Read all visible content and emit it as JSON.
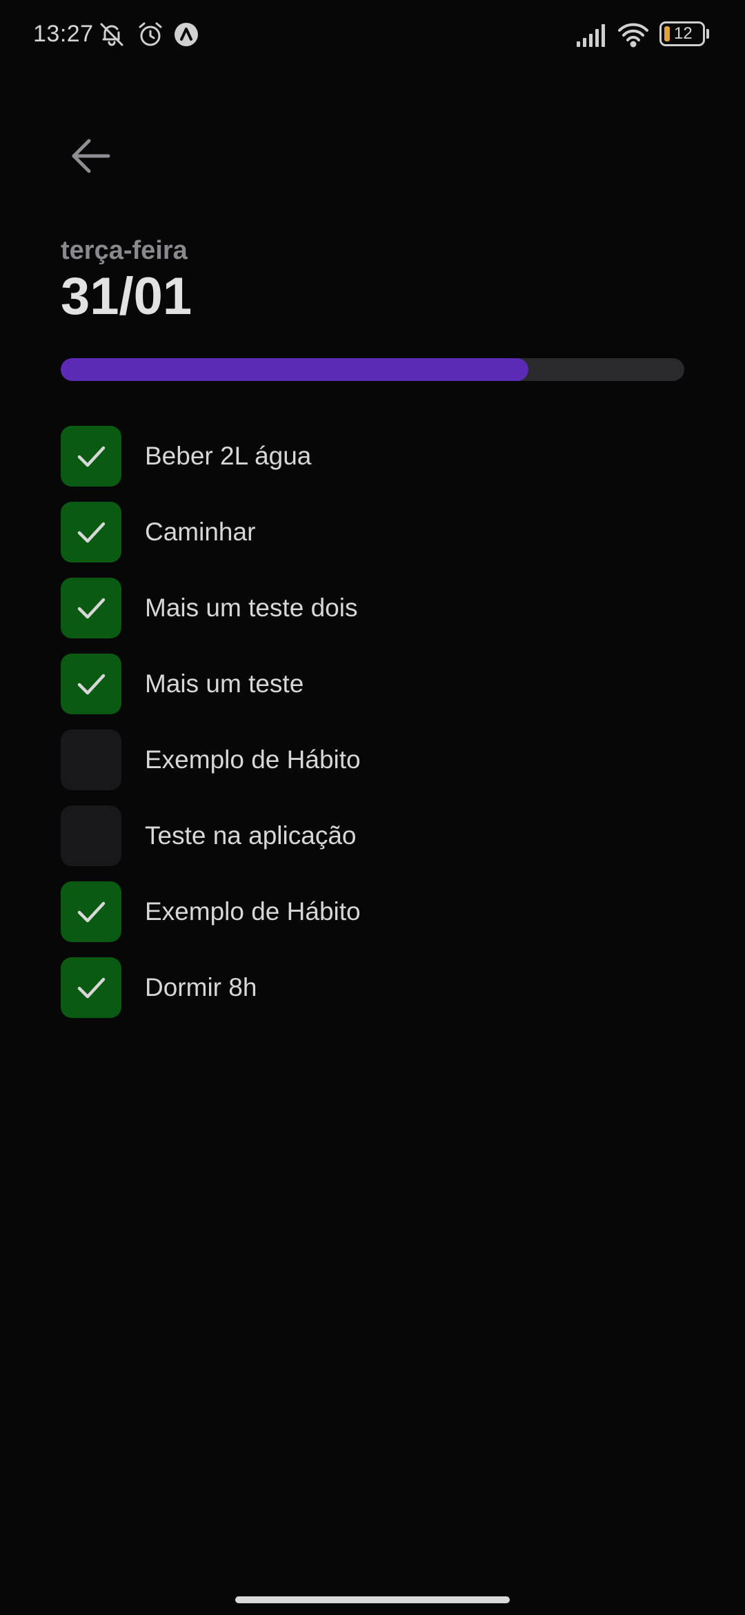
{
  "status_bar": {
    "time": "13:27",
    "battery_level": "12",
    "icons": [
      "muted-bell-icon",
      "alarm-icon",
      "app-notification-icon",
      "signal-icon",
      "wifi-icon",
      "battery-icon"
    ],
    "battery_color": "#e0a13a"
  },
  "header": {
    "back_icon": "arrow-left-icon",
    "weekday": "terça-feira",
    "date": "31/01"
  },
  "progress": {
    "completed_fraction": 0.75,
    "fill_color": "#5b2bb5",
    "track_color": "#2a2a2d"
  },
  "habits": [
    {
      "label": "Beber 2L água",
      "checked": true
    },
    {
      "label": "Caminhar",
      "checked": true
    },
    {
      "label": "Mais um teste dois",
      "checked": true
    },
    {
      "label": "Mais um teste",
      "checked": true
    },
    {
      "label": "Exemplo de Hábito",
      "checked": false
    },
    {
      "label": "Teste na aplicação",
      "checked": false
    },
    {
      "label": "Exemplo de Hábito",
      "checked": true
    },
    {
      "label": "Dormir 8h",
      "checked": true
    }
  ],
  "colors": {
    "background": "#070707",
    "checked": "#0b5a12",
    "unchecked": "#18181b"
  }
}
